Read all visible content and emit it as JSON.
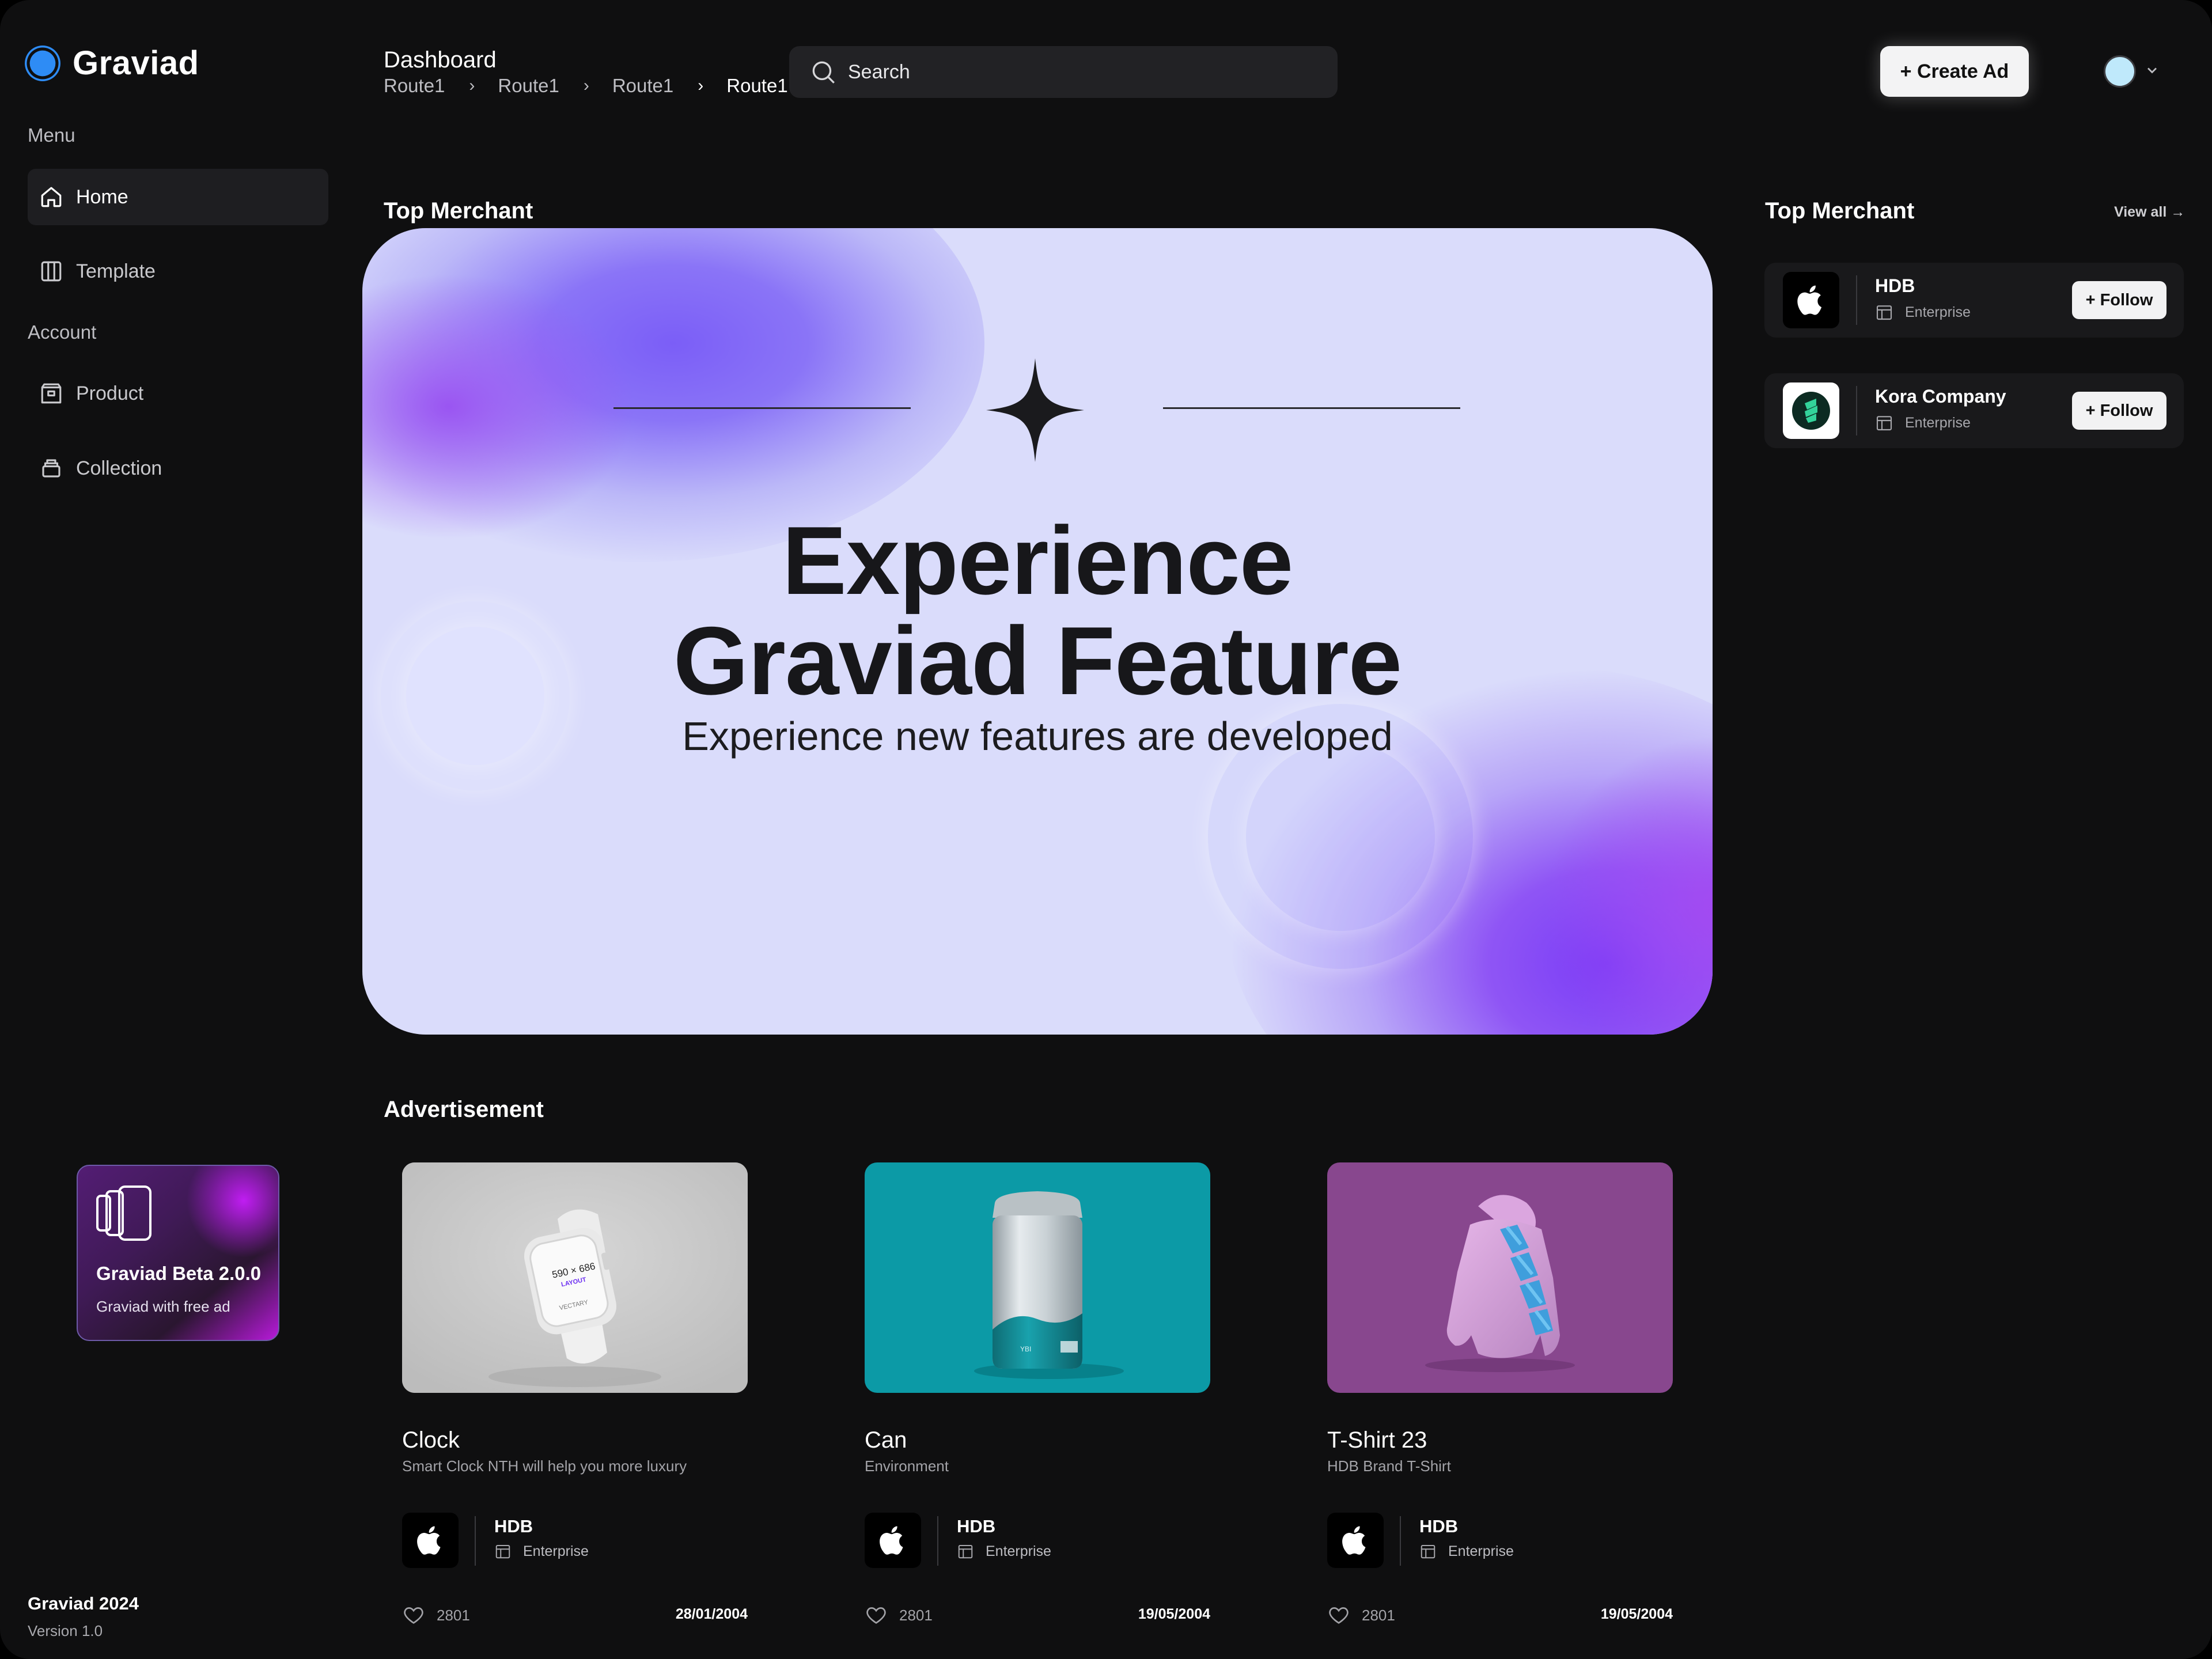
{
  "app": {
    "name": "Graviad"
  },
  "sidebar": {
    "menu_heading": "Menu",
    "account_heading": "Account",
    "items": [
      {
        "label": "Home",
        "icon": "home-icon",
        "active": true
      },
      {
        "label": "Template",
        "icon": "template-icon"
      },
      {
        "label": "Product",
        "icon": "product-icon"
      },
      {
        "label": "Collection",
        "icon": "collection-icon"
      }
    ],
    "promo": {
      "title": "Graviad Beta 2.0.0",
      "subtitle": "Graviad with free ad"
    },
    "footer": {
      "title": "Graviad 2024",
      "version": "Version 1.0"
    }
  },
  "header": {
    "title": "Dashboard",
    "breadcrumbs": [
      "Route1",
      "Route1",
      "Route1",
      "Route1"
    ],
    "search_placeholder": "Search",
    "create_label": "+ Create Ad"
  },
  "hero": {
    "section_label": "Top Merchant",
    "title": "Experience Graviad Feature",
    "subtitle": "Experience new features are developed"
  },
  "merchants": {
    "title": "Top Merchant",
    "view_all": "View all →",
    "items": [
      {
        "name": "HDB",
        "type": "Enterprise",
        "follow": "+ Follow",
        "logo": "apple-logo"
      },
      {
        "name": "Kora Company",
        "type": "Enterprise",
        "follow": "+ Follow",
        "logo": "kora-logo"
      }
    ]
  },
  "ads": {
    "title": "Advertisement",
    "items": [
      {
        "title": "Clock",
        "desc": "Smart Clock NTH will help you more luxury",
        "merchant": "HDB",
        "merchant_type": "Enterprise",
        "likes": "2801",
        "date": "28/01/2004",
        "watch_text": "590 × 686",
        "watch_sub": "LAYOUT",
        "watch_brand": "VECTARY",
        "bg": "#c7c7c7"
      },
      {
        "title": "Can",
        "desc": "Environment",
        "merchant": "HDB",
        "merchant_type": "Enterprise",
        "likes": "2801",
        "date": "19/05/2004",
        "bg": "#0c9aa6"
      },
      {
        "title": "T-Shirt 23",
        "desc": "HDB Brand T-Shirt",
        "merchant": "HDB",
        "merchant_type": "Enterprise",
        "likes": "2801",
        "date": "19/05/2004",
        "bg": "#88478e"
      }
    ]
  }
}
